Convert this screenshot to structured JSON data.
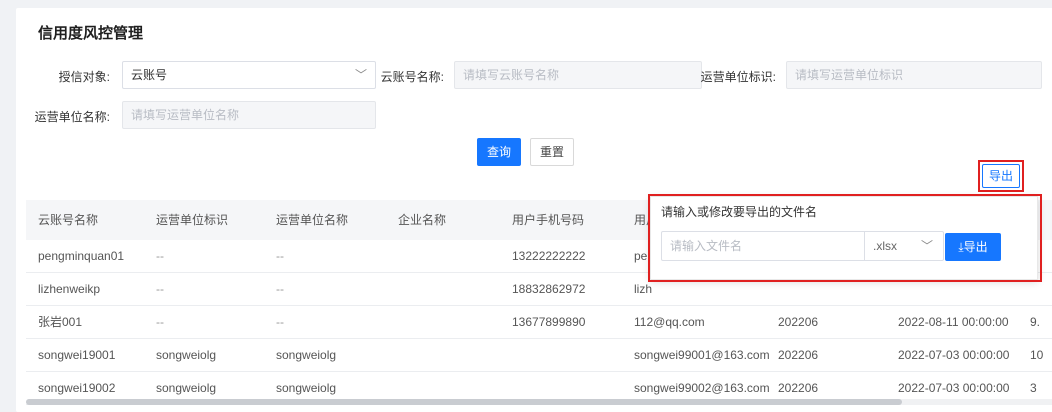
{
  "page": {
    "title": "信用度风控管理"
  },
  "filters": {
    "target_label": "授信对象:",
    "target_value": "云账号",
    "account_name_label": "云账号名称:",
    "account_name_placeholder": "请填写云账号名称",
    "unit_id_label": "运营单位标识:",
    "unit_id_placeholder": "请填写运营单位标识",
    "unit_name_label": "运营单位名称:",
    "unit_name_placeholder": "请填写运营单位名称"
  },
  "actions": {
    "query": "查询",
    "reset": "重置",
    "export": "导出"
  },
  "table": {
    "headers": [
      "云账号名称",
      "运营单位标识",
      "运营单位名称",
      "企业名称",
      "用户手机号码",
      "用户"
    ],
    "rows": [
      [
        "pengminquan01",
        "--",
        "--",
        "",
        "13222222222",
        "pe",
        "",
        "",
        ""
      ],
      [
        "lizhenweikp",
        "--",
        "--",
        "",
        "18832862972",
        "lizh",
        "",
        "",
        ""
      ],
      [
        "张岩001",
        "--",
        "--",
        "",
        "13677899890",
        "112@qq.com",
        "202206",
        "2022-08-11 00:00:00",
        "9."
      ],
      [
        "songwei19001",
        "songweiolg",
        "songweiolg",
        "",
        "",
        "songwei99001@163.com",
        "202206",
        "2022-07-03 00:00:00",
        "10"
      ],
      [
        "songwei19002",
        "songweiolg",
        "songweiolg",
        "",
        "",
        "songwei99002@163.com",
        "202206",
        "2022-07-03 00:00:00",
        "3"
      ]
    ]
  },
  "export_popover": {
    "title": "请输入或修改要导出的文件名",
    "filename_placeholder": "请输入文件名",
    "extension": ".xlsx",
    "button": "导出",
    "button_icon": "download-icon"
  },
  "colors": {
    "primary": "#1677ff",
    "highlight": "#e02020"
  },
  "icons": {
    "select_arrow": "chevron-down-icon"
  }
}
